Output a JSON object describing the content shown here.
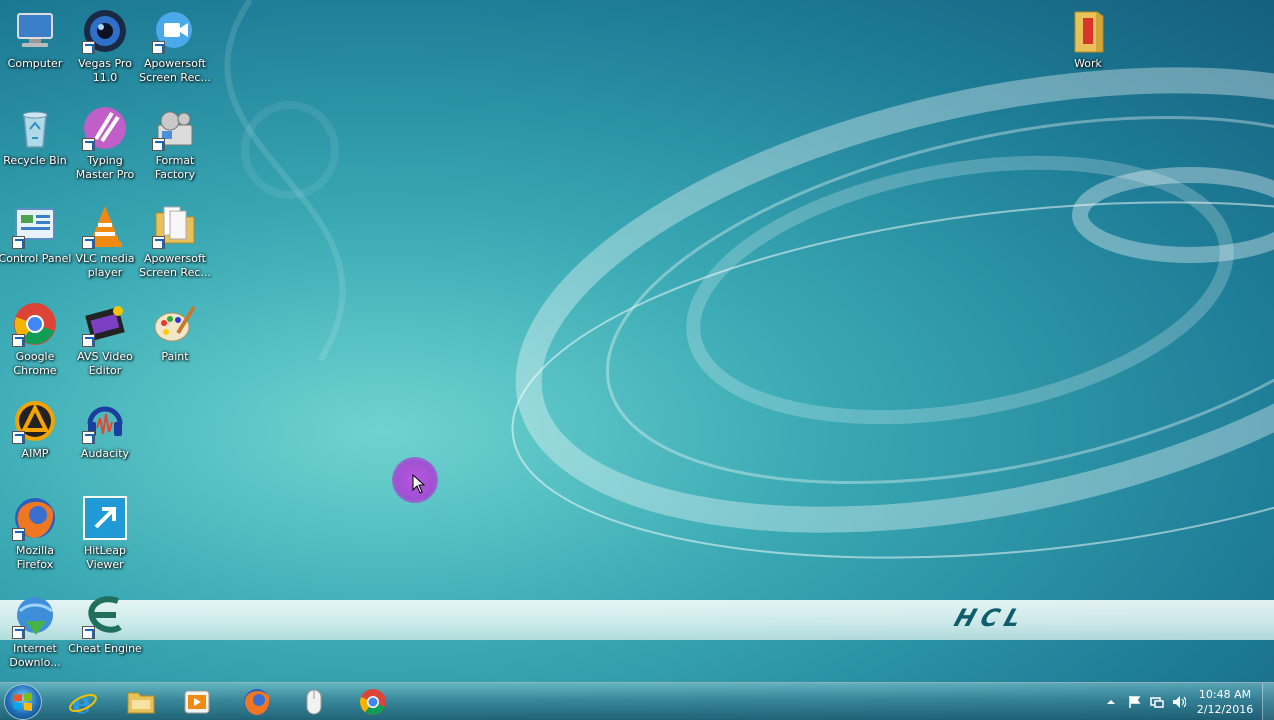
{
  "desktop": {
    "icons": [
      {
        "label": "Computer",
        "icon": "computer-icon"
      },
      {
        "label": "Vegas Pro 11.0",
        "icon": "vegas-pro-icon"
      },
      {
        "label": "Apowersoft Screen Rec...",
        "icon": "apowersoft-recorder-icon"
      },
      {
        "label": "Recycle Bin",
        "icon": "recycle-bin-icon"
      },
      {
        "label": "Typing Master Pro",
        "icon": "typing-master-icon"
      },
      {
        "label": "Format Factory",
        "icon": "format-factory-icon"
      },
      {
        "label": "Control Panel",
        "icon": "control-panel-icon"
      },
      {
        "label": "VLC media player",
        "icon": "vlc-icon"
      },
      {
        "label": "Apowersoft Screen Rec...",
        "icon": "apowersoft-folder-icon"
      },
      {
        "label": "Google Chrome",
        "icon": "chrome-icon"
      },
      {
        "label": "AVS Video Editor",
        "icon": "avs-video-editor-icon"
      },
      {
        "label": "Paint",
        "icon": "paint-icon"
      },
      {
        "label": "AIMP",
        "icon": "aimp-icon"
      },
      {
        "label": "Audacity",
        "icon": "audacity-icon"
      },
      {
        "label": "Mozilla Firefox",
        "icon": "firefox-icon"
      },
      {
        "label": "HitLeap Viewer",
        "icon": "hitleap-icon"
      },
      {
        "label": "Internet Downlo...",
        "icon": "internet-download-manager-icon"
      },
      {
        "label": "Cheat Engine",
        "icon": "cheat-engine-icon"
      },
      {
        "label": "Work",
        "icon": "folder-icon"
      }
    ],
    "wallpaper_brand": "HCL"
  },
  "taskbar": {
    "pinned": [
      {
        "name": "Internet Explorer",
        "icon": "internet-explorer-icon"
      },
      {
        "name": "Windows Explorer",
        "icon": "file-explorer-icon"
      },
      {
        "name": "Windows Media Player",
        "icon": "media-player-icon"
      },
      {
        "name": "Mozilla Firefox",
        "icon": "firefox-icon"
      },
      {
        "name": "Mouse",
        "icon": "mouse-icon"
      },
      {
        "name": "Google Chrome",
        "icon": "chrome-icon"
      }
    ],
    "clock": {
      "time": "10:48 AM",
      "date": "2/12/2016"
    }
  },
  "colors": {
    "wallpaper_teal": "#3aa9b4",
    "cursor_highlight": "#b450de",
    "taskbar": "#2d6f86"
  }
}
